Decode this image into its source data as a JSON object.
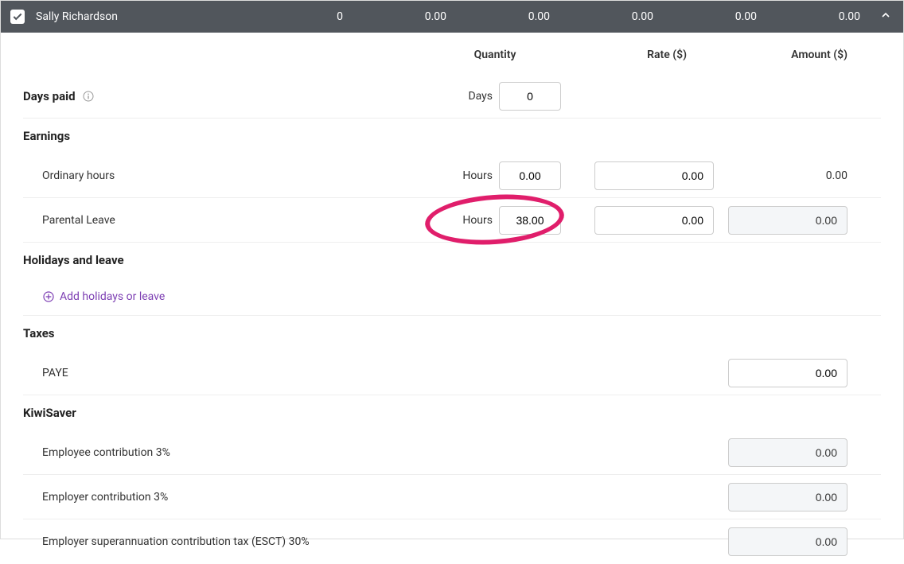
{
  "header": {
    "name": "Sally Richardson",
    "values": [
      "0",
      "0.00",
      "0.00",
      "0.00",
      "0.00",
      "0.00"
    ]
  },
  "columns": {
    "quantity": "Quantity",
    "rate": "Rate ($)",
    "amount": "Amount ($)"
  },
  "days_paid": {
    "label": "Days paid",
    "unit": "Days",
    "quantity": "0"
  },
  "earnings": {
    "heading": "Earnings",
    "ordinary": {
      "label": "Ordinary hours",
      "unit": "Hours",
      "quantity": "0.00",
      "rate": "0.00",
      "amount": "0.00"
    },
    "parental": {
      "label": "Parental Leave",
      "unit": "Hours",
      "quantity": "38.00",
      "rate": "0.00",
      "amount": "0.00"
    }
  },
  "holidays": {
    "heading": "Holidays and leave",
    "add_link": "Add holidays or leave"
  },
  "taxes": {
    "heading": "Taxes",
    "paye": {
      "label": "PAYE",
      "amount": "0.00"
    }
  },
  "kiwisaver": {
    "heading": "KiwiSaver",
    "employee": {
      "label": "Employee contribution 3%",
      "amount": "0.00"
    },
    "employer": {
      "label": "Employer contribution 3%",
      "amount": "0.00"
    },
    "esct": {
      "label": "Employer superannuation contribution tax (ESCT) 30%",
      "amount": "0.00"
    }
  }
}
